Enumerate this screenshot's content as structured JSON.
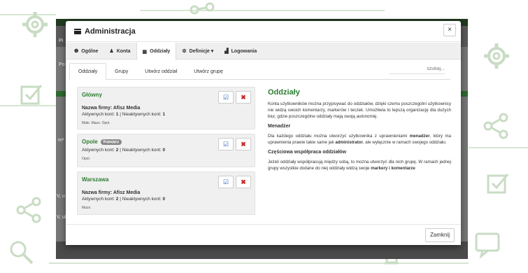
{
  "modal": {
    "title": "Administracja",
    "close_symbol": "×",
    "footer_close": "Zamknij"
  },
  "nav": [
    {
      "label": "Ogólne",
      "icon": "info-icon"
    },
    {
      "label": "Konta",
      "icon": "user-icon"
    },
    {
      "label": "Oddziały",
      "icon": "building-icon"
    },
    {
      "label": "Definicje ▾",
      "icon": "gear-icon"
    },
    {
      "label": "Logowania",
      "icon": "bar-chart-icon"
    }
  ],
  "subtabs": [
    {
      "label": "Oddziały"
    },
    {
      "label": "Grupy"
    },
    {
      "label": "Utwórz oddział"
    },
    {
      "label": "Utwórz grupę"
    }
  ],
  "search": {
    "placeholder": "szukaj..."
  },
  "departments": [
    {
      "name": "Główny",
      "company_label": "Nazwa firmy: Afisz Media",
      "active_label": "Aktywnych kont:",
      "active": "1",
      "inactive_label": "Nieaktywnych kont:",
      "inactive": "1",
      "tags": "Mało. Mazo. Opol."
    },
    {
      "name": "Opole",
      "badge": "Kupujący",
      "active_label": "Aktywnych kont:",
      "active": "2",
      "inactive_label": "Nieaktywnych kont:",
      "inactive": "0",
      "tags": "Opol."
    },
    {
      "name": "Warszawa",
      "company_label": "Nazwa firmy: Afisz Media",
      "active_label": "Aktywnych kont:",
      "active": "2",
      "inactive_label": "Nieaktywnych kont:",
      "inactive": "0",
      "tags": "Mazo."
    }
  ],
  "info": {
    "title": "Oddziały",
    "p1": "Konta użytkowników można przypisywać do oddziałów, dzięki czemu poszczególni użytkownicy nie widzą swoich komentarzy, markerów i teczek. Umożliwia to lepszą organizację dla dużych biur, gdzie poszczególne oddziały mają swoją autonomię.",
    "h_manager": "Menadżer",
    "p2_a": "Dla każdego oddziału można utworzyć użytkownika z uprawnieniami ",
    "p2_b": "menadżer",
    "p2_c": ", który ma uprawnienia prawie takie same jak ",
    "p2_d": "administrator",
    "p2_e": ", ale wyłącznie w ramach swojego oddziału.",
    "h_coop": "Częściowa współpraca oddziałów",
    "p3_a": "Jeżeli oddziały współpracują między sobą, to można utworzyć dla nich grupę. W ramach jednej grupy wszystkie dodane do niej oddziały widzą swoje ",
    "p3_b": "markery i komentarze"
  },
  "background_edge": {
    "e1": "Pi",
    "e2": "Po",
    "e3": "m²",
    "e4": "V, u",
    "e5": "V, ul"
  },
  "colors": {
    "accent_green": "#2e7d32",
    "edit_blue": "#2a5fb0",
    "delete_red": "#c62828"
  }
}
